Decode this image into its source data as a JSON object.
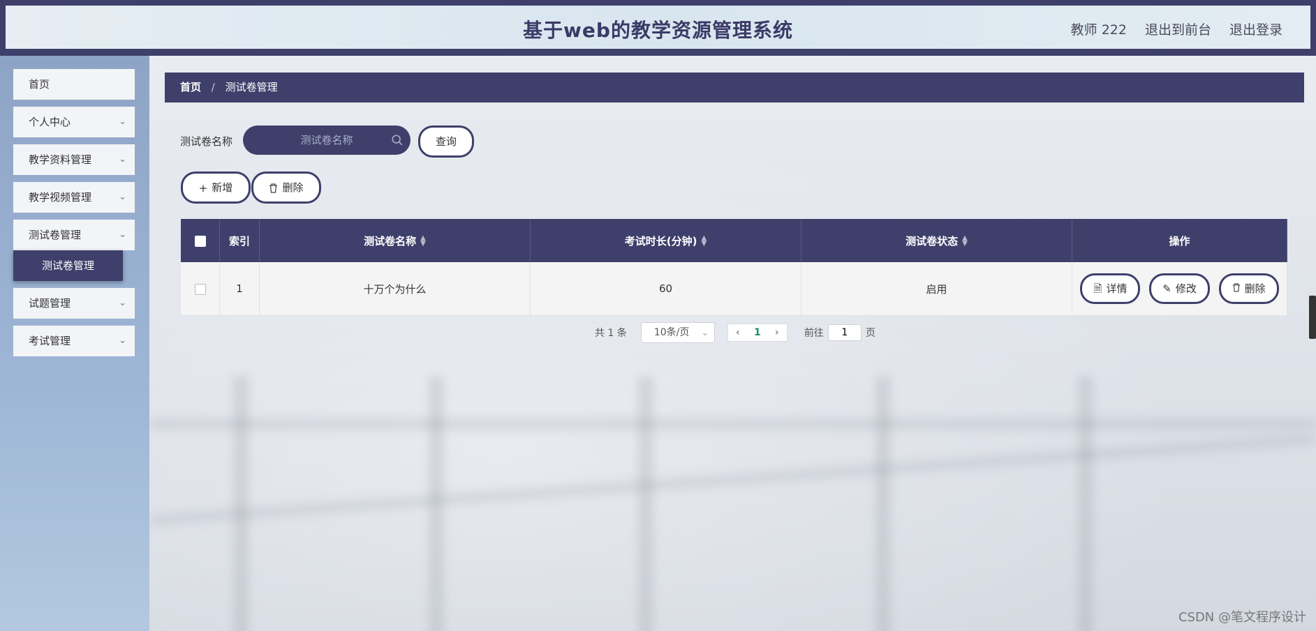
{
  "header": {
    "title": "基于web的教学资源管理系统",
    "user_label": "教师 222",
    "back_to_front": "退出到前台",
    "logout": "退出登录"
  },
  "sidebar": {
    "items": [
      {
        "label": "首页"
      },
      {
        "label": "个人中心"
      },
      {
        "label": "教学资料管理"
      },
      {
        "label": "教学视频管理"
      },
      {
        "label": "测试卷管理"
      },
      {
        "label": "测试卷管理"
      },
      {
        "label": "试题管理"
      },
      {
        "label": "考试管理"
      }
    ]
  },
  "breadcrumb": {
    "home": "首页",
    "separator": "/",
    "current": "测试卷管理"
  },
  "search": {
    "label": "测试卷名称",
    "placeholder": "测试卷名称",
    "query_button": "查询"
  },
  "actions": {
    "add": "新增",
    "delete": "删除"
  },
  "table": {
    "headers": {
      "index": "索引",
      "name": "测试卷名称",
      "duration": "考试时长(分钟)",
      "status": "测试卷状态",
      "ops": "操作"
    },
    "rows": [
      {
        "index": "1",
        "name": "十万个为什么",
        "duration": "60",
        "status": "启用"
      }
    ],
    "row_actions": {
      "detail": "详情",
      "edit": "修改",
      "delete": "删除"
    }
  },
  "pagination": {
    "total_text": "共 1 条",
    "page_size": "10条/页",
    "current_page": "1",
    "goto_label": "前往",
    "goto_value": "1",
    "page_suffix": "页"
  },
  "watermark": "CSDN @笔文程序设计",
  "colors": {
    "primary": "#3f3f6b",
    "current_page": "#1a8f5b"
  }
}
